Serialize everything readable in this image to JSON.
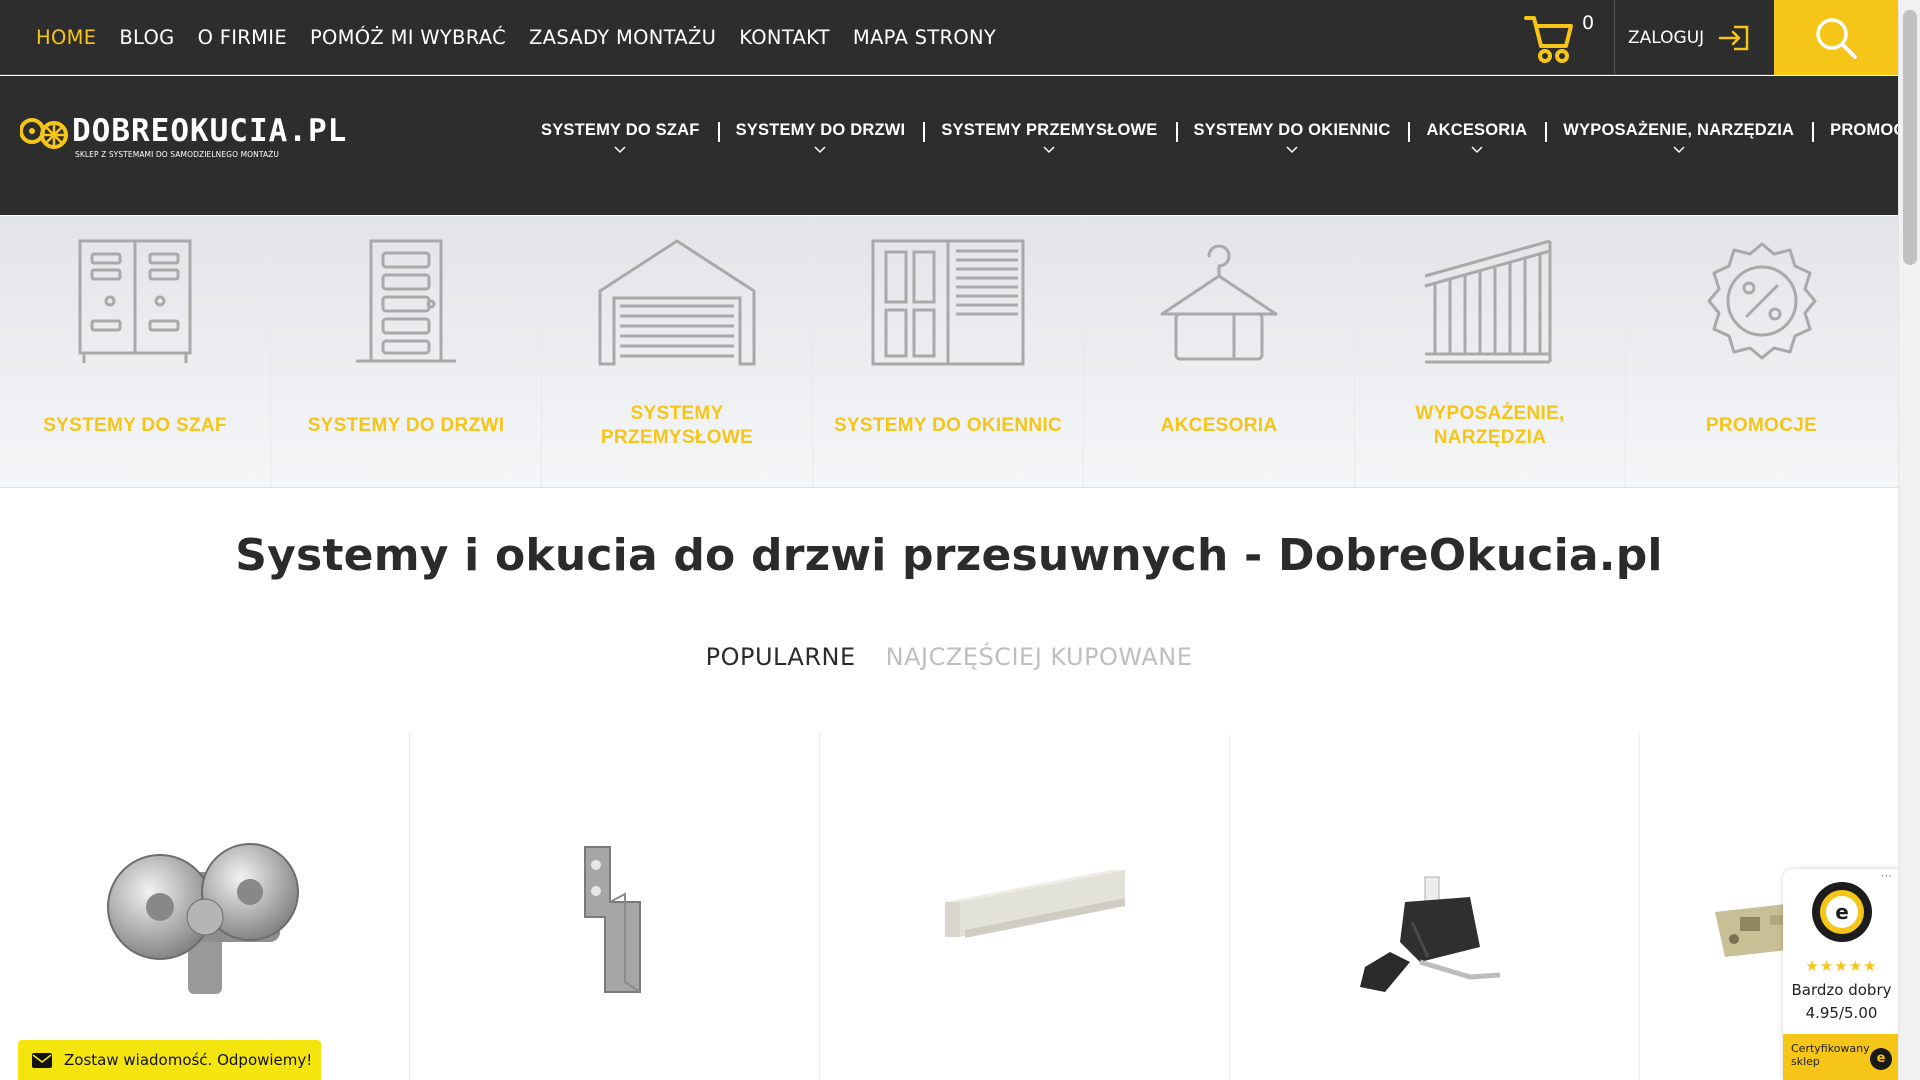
{
  "topnav": {
    "items": [
      {
        "label": "HOME",
        "active": true
      },
      {
        "label": "BLOG"
      },
      {
        "label": "O FIRMIE"
      },
      {
        "label": "POMÓŻ MI WYBRAĆ"
      },
      {
        "label": "ZASADY MONTAŻU"
      },
      {
        "label": "KONTAKT"
      },
      {
        "label": "MAPA STRONY"
      }
    ],
    "cart_count": "0",
    "login_label": "ZALOGUJ",
    "accent_color": "#f5c518"
  },
  "logo": {
    "name": "DOBREOKUCIA.PL",
    "tagline": "SKLEP Z SYSTEMAMI DO SAMODZIELNEGO MONTAŻU"
  },
  "mainnav": {
    "items": [
      {
        "label": "SYSTEMY DO SZAF",
        "has_dropdown": true
      },
      {
        "label": "SYSTEMY DO DRZWI",
        "has_dropdown": true
      },
      {
        "label": "SYSTEMY PRZEMYSŁOWE",
        "has_dropdown": true
      },
      {
        "label": "SYSTEMY DO OKIENNIC",
        "has_dropdown": true
      },
      {
        "label": "AKCESORIA",
        "has_dropdown": true
      },
      {
        "label": "WYPOSAŻENIE, NARZĘDZIA",
        "has_dropdown": true
      },
      {
        "label": "PROMOCJE",
        "has_dropdown": false
      }
    ]
  },
  "categories": [
    {
      "label": "SYSTEMY DO SZAF",
      "icon": "wardrobe-icon"
    },
    {
      "label": "SYSTEMY DO DRZWI",
      "icon": "door-icon"
    },
    {
      "label": "SYSTEMY PRZEMYSŁOWE",
      "icon": "garage-icon"
    },
    {
      "label": "SYSTEMY DO OKIENNIC",
      "icon": "shutter-icon"
    },
    {
      "label": "AKCESORIA",
      "icon": "hanger-icon"
    },
    {
      "label": "WYPOSAŻENIE, NARZĘDZIA",
      "icon": "stairs-icon"
    },
    {
      "label": "PROMOCJE",
      "icon": "percent-badge-icon"
    }
  ],
  "main": {
    "headline": "Systemy i okucia do drzwi przesuwnych - DobreOkucia.pl",
    "tabs": [
      {
        "label": "POPULARNE",
        "active": true
      },
      {
        "label": "NAJCZĘŚCIEJ KUPOWANE",
        "active": false
      }
    ]
  },
  "products": [
    {
      "icon": "roller-carriage-icon"
    },
    {
      "icon": "mounting-bracket-icon"
    },
    {
      "icon": "rail-profile-icon"
    },
    {
      "icon": "door-stopper-icon"
    },
    {
      "icon": "soft-close-mechanism-icon"
    }
  ],
  "message_widget": {
    "label": "Zostaw wiadomość. Odpowiemy!"
  },
  "trust_badge": {
    "stars": "★★★★★",
    "rating_text": "Bardzo dobry",
    "rating_value": "4.95/5.00",
    "certified": "Certyfikowany sklep",
    "seal_text": "e"
  }
}
